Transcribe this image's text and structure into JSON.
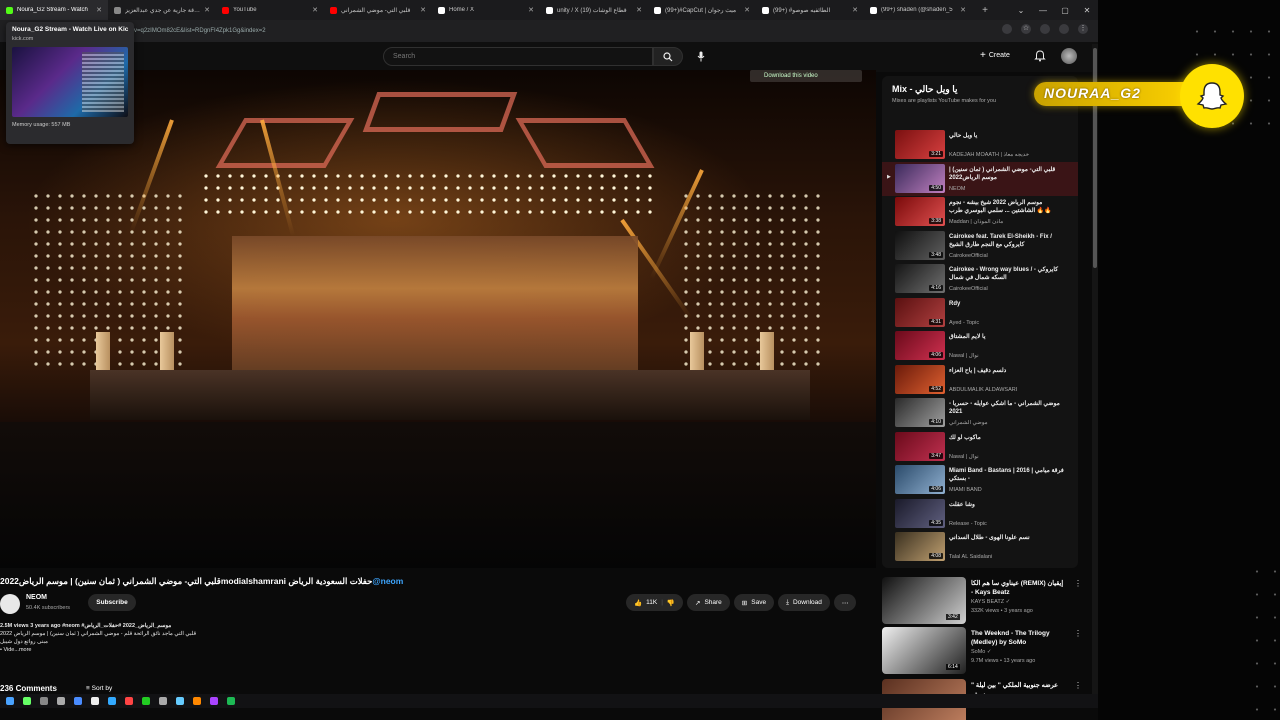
{
  "browser": {
    "tabs": [
      {
        "title": "Noura_G2 Stream - Watch",
        "color": "#53fc18",
        "active": true
      },
      {
        "title": "صدقة جارية عن جدي عبدالعزيز",
        "color": "#888888",
        "active": false
      },
      {
        "title": "YouTube",
        "color": "#ff0000",
        "active": false
      },
      {
        "title": "قلبي التي- موضي الشمراني",
        "color": "#ff0000",
        "active": false
      },
      {
        "title": "Home / X",
        "color": "#ffffff",
        "active": false
      },
      {
        "title": "unity / X قطاع الوشات (19)",
        "color": "#ffffff",
        "active": false
      },
      {
        "title": "(99+)#CapCut | ميث رجوان",
        "color": "#ffffff",
        "active": false
      },
      {
        "title": "(99+) #الطائفيه صوصو",
        "color": "#ffffff",
        "active": false
      },
      {
        "title": "(99+) shaden (@shaden_5",
        "color": "#ffffff",
        "active": false
      }
    ],
    "url": "v=q2zIMOm82cE&list=RDgnFI4Zpk1Gg&index=2",
    "tab_preview": {
      "title": "Noura_G2 Stream - Watch Live on Kick",
      "domain": "kick.com",
      "memory": "Memory usage: 557 MB"
    }
  },
  "youtube": {
    "search_placeholder": "Search",
    "create_label": "Create",
    "download_overlay": "Download this video",
    "video": {
      "title_prefix": "قلبي التي- موضي الشمراني ( ثمان سنين) | موسم الرياض2022modialshamrani حفلات السعودية الرياض",
      "title_tag": "@neom",
      "channel": "NEOM",
      "subscribers": "50.4K subscribers",
      "subscribe_label": "Subscribe",
      "likes": "11K",
      "share_label": "Share",
      "save_label": "Save",
      "download_label": "Download",
      "meta": "2.5M views  3 years ago  #neom #موسم_الرياض_2022 #حفلات_الرياض",
      "desc_line1": "قلبي التي ماجد نائق الرائحة قلم - موضي الشمراني ( ثمان سنين) | موسم الرياض 2022",
      "desc_line2": "مبنى رواتع دول شيبل",
      "desc_more": "• Vide...more",
      "comments": "236 Comments",
      "sort_by": "Sort by"
    },
    "mix": {
      "title": "Mix - يا ويل حالي",
      "subtitle": "Mixes are playlists YouTube makes for you",
      "items": [
        {
          "title": "يا ويل حالي",
          "channel": "KADEJAH MOAATH | خديجه معاذ",
          "duration": "3:21",
          "c1": "#7a1010",
          "c2": "#d84040"
        },
        {
          "title": "قلبي التي- موضي الشمراني ( ثمان سنين) | موسم الرياض2022",
          "channel": "NEOM",
          "duration": "4:50",
          "c1": "#3a2a5a",
          "c2": "#c080c0",
          "now": true
        },
        {
          "title": "موسم الرياض 2022 شيخ بيشه - نجوم الشاشتين ... سلمي البوسري طرب 🔥🔥",
          "channel": "Maddan | ماذن الموذان",
          "duration": "3:38",
          "c1": "#7a0a0a",
          "c2": "#e05050"
        },
        {
          "title": "Cairokee feat. Tarek El-Sheikh - Fix / كايروكي مع النجم طارق الشيخ",
          "channel": "CairokeeOfficial",
          "duration": "3:48",
          "c1": "#101010",
          "c2": "#606060"
        },
        {
          "title": "Cairokee - Wrong way blues / كايروكي - السكه شمال في شمال",
          "channel": "CairokeeOfficial",
          "duration": "4:16",
          "c1": "#151515",
          "c2": "#707070"
        },
        {
          "title": "Rdy",
          "channel": "Ayed - Topic",
          "duration": "4:31",
          "c1": "#5a1010",
          "c2": "#b04040"
        },
        {
          "title": "يا لايم المشتاق",
          "channel": "Nawal | نوال",
          "duration": "4:06",
          "c1": "#6a0a1a",
          "c2": "#d03050"
        },
        {
          "title": "دلسم دقيف | ياح العزاء",
          "channel": "ABDULMALIK ALDAWSARI",
          "duration": "4:52",
          "c1": "#6a1a0a",
          "c2": "#e06030"
        },
        {
          "title": "موضي الشمراني - ما اشكي عوايله - حسريا - 2021",
          "channel": "موضي الشمراني",
          "duration": "4:10",
          "c1": "#2a2a2a",
          "c2": "#a0a0a0"
        },
        {
          "title": "ماكوب لو لك",
          "channel": "Nawal | نوال",
          "duration": "3:47",
          "c1": "#6a0a1a",
          "c2": "#c03050"
        },
        {
          "title": "Miami Band - Bastans | 2016 | فرقة ميامي - بستكي",
          "channel": "MIAMI BAND",
          "duration": "4:06",
          "c1": "#2a4a6a",
          "c2": "#90b0d0"
        },
        {
          "title": "وشا عقلت",
          "channel": "Release - Topic",
          "duration": "4:35",
          "c1": "#1a1a2a",
          "c2": "#606080"
        },
        {
          "title": "نسم علونا الهوى - طلال السداني",
          "channel": "Talal AL Saidalani",
          "duration": "4:08",
          "c1": "#3a3020",
          "c2": "#c0a070"
        }
      ]
    },
    "recommendations": [
      {
        "title": "عيناوي سا هم الكا (REMIX) إيقيان - Kays Beatz",
        "channel": "KAYS BEATZ ✓",
        "meta": "332K views • 3 years ago",
        "duration": "3:42",
        "c1": "#101010",
        "c2": "#d0d0d0"
      },
      {
        "title": "The Weeknd - The Trilogy (Medley) by SoMo",
        "channel": "SoMo ✓",
        "meta": "9.7M views • 13 years ago",
        "duration": "6:14",
        "c1": "#f0f0f0",
        "c2": "#202020"
      },
      {
        "title": "\" عرضه جنوبية الملكي \" بين ليلة سيف",
        "channel": "",
        "meta": "",
        "duration": "",
        "c1": "#5a3020",
        "c2": "#c08060"
      }
    ]
  },
  "overlay": {
    "streamer_name": "NOURAA_G2",
    "accent": "#ffd400"
  }
}
